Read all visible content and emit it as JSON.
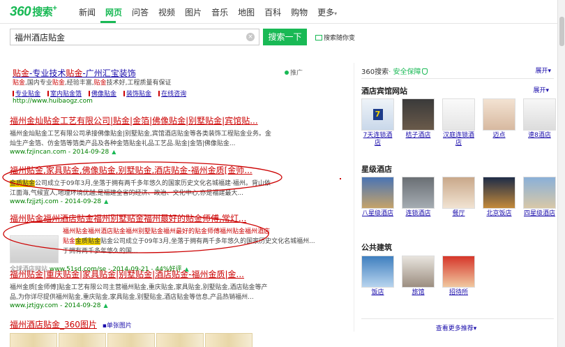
{
  "logo": {
    "number": "360",
    "text": "搜索",
    "plus": "+"
  },
  "nav": [
    "新闻",
    "网页",
    "问答",
    "视频",
    "图片",
    "音乐",
    "地图",
    "百科",
    "购物",
    "更多"
  ],
  "nav_more_arrow": "▾",
  "search": {
    "query": "福州酒店贴金",
    "button": "搜索一下",
    "follow": "搜索随你变"
  },
  "clear_icon": "×",
  "ad": {
    "title_parts": [
      "贴金",
      "-专业技术",
      "贴金",
      "-广州汇宝装饰"
    ],
    "tag": "推广",
    "desc_parts": [
      "贴金",
      ",国内专业",
      "贴金",
      ",经验丰富,",
      "贴金",
      "技术好,工程质量有保证"
    ],
    "sitelinks": [
      "专业贴金",
      "室内贴金箔",
      "佛像贴金",
      "装饰贴金",
      "在线咨询"
    ],
    "url": "http://www.huibaogz.com"
  },
  "results": [
    {
      "title": "福州金灿贴金工艺有限公司|贴金|金箔|佛像贴金|别墅贴金|宾馆贴...",
      "desc1": "福州金灿贴金工艺有限公司承接佛像贴金|别墅贴金,宾馆酒店贴金等各类装饰工程贴金业务。金",
      "desc2": "灿生产金箔、仿金箔等箔类产品及各种金箔贴金礼品工艺品.贴金|金箔|佛像贴金...",
      "url": "www.fzjincan.com",
      "date": "2014-09-28"
    },
    {
      "title": "福州贴金,家具贴金,佛像贴金,别墅贴金,酒店贴金-福州金质[金师...",
      "hl": "金质贴金",
      "desc1": "公司成立于09年3月,坐落于拥有两千多年悠久的国家历史文化名城福建·福州。背山依",
      "desc2": "江面海,气候宜人,地理环境优越,是福建全省的经济、政治、文化中心,亦是福建最大...",
      "url": "www.fzjjztj.com",
      "date": "2014-09-28"
    },
    {
      "title": "福州贴金福州酒店贴金福州别墅贴金福州最好的贴金师傅,常灯...",
      "desc1": "福州贴金福州酒店贴金福州别墅贴金福州最好的贴金师傅福州贴金福州酒店",
      "desc2": "贴金公司成立于09年3月,坐落于拥有两千多年悠久的国家历史文化名城福州...",
      "desc3": "于拥有两千多年悠久的国...",
      "hl": "金质贴金",
      "url": "www.51sd.com/se",
      "date": "2014-09-21",
      "extra": "44%好评",
      "label": "全球酒店网站"
    },
    {
      "title": "福州贴金|重庆贴金|家具贴金|别墅贴金|酒店贴金-福州金质|金...",
      "desc1": "福州金质[金师傅]贴金工艺有限公司主营福州贴金,重庆贴金,家具贴金,别墅贴金,酒店贴金等产",
      "desc2": "品,为你详尽提供福州贴金,重庆贴金,家具贴金,别墅贴金,酒店贴金等信息,产品热销福州...",
      "url": "www.jztjgy.com",
      "date": "2014-09-28"
    },
    {
      "title": "福州酒店贴金_360图片",
      "tag": "单张图片"
    }
  ],
  "right": {
    "header_brand": "360搜索",
    "header_safe": "· 安全保障",
    "expand": "展开",
    "expand_arrow": "▾",
    "sec1_title": "酒店宾馆网站",
    "sec1_expand": "展开",
    "sec1_cards": [
      "7天连锁酒店",
      "桔子酒店",
      "汉庭连锁酒店",
      "迈点",
      "速8酒店"
    ],
    "sec2_title": "星级酒店",
    "sec2_cards": [
      "八星级酒店",
      "连锁酒店",
      "餐厅",
      "北京饭店",
      "四星级酒店"
    ],
    "sec3_title": "公共建筑",
    "sec3_cards": [
      "饭店",
      "旅馆",
      "招待所"
    ],
    "more": "查看更多推荐",
    "more_arrow": "▾"
  },
  "colors": {
    "brand": "#19b955",
    "link": "#1a0dab",
    "keyword": "#cc0000",
    "url": "#008000"
  }
}
